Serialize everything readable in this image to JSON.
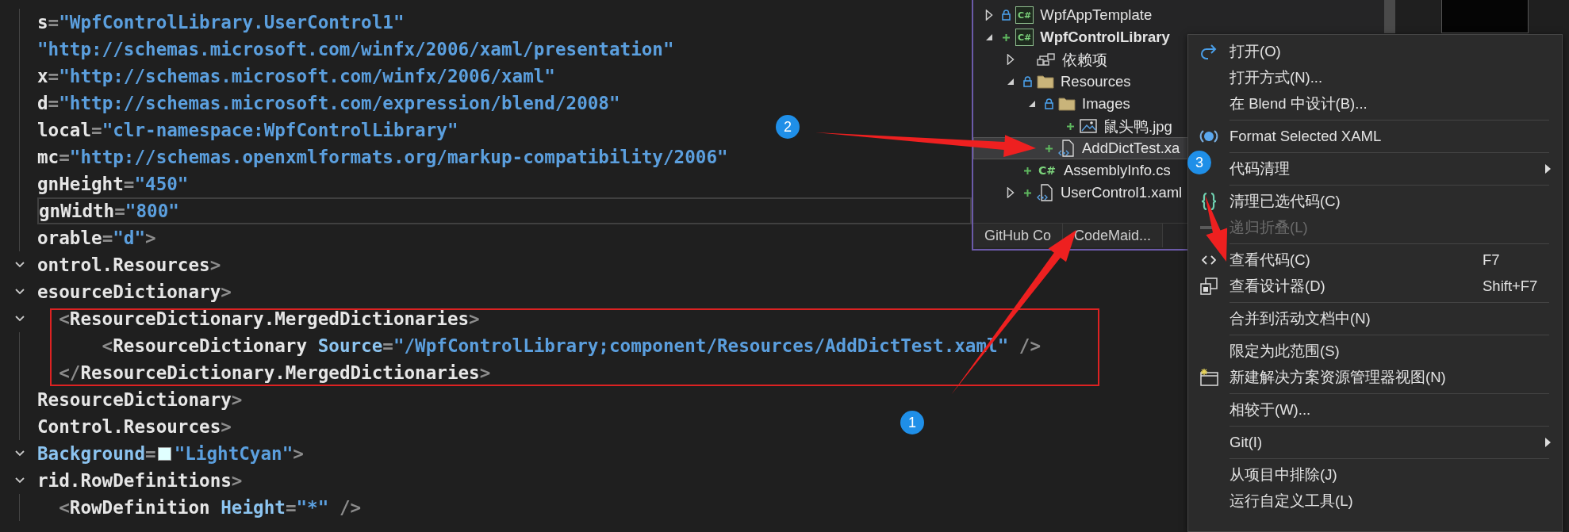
{
  "editor": {
    "lines": [
      {
        "fold": false,
        "current": false,
        "tokens": [
          {
            "t": "s",
            "kind": "name"
          },
          {
            "t": "=",
            "kind": "punct"
          },
          {
            "t": "\"WpfControlLibrary.UserControl1\"",
            "kind": "value"
          }
        ]
      },
      {
        "fold": false,
        "current": false,
        "tokens": [
          {
            "t": "\"http://schemas.microsoft.com/winfx/2006/xaml/presentation\"",
            "kind": "value"
          }
        ]
      },
      {
        "fold": false,
        "current": false,
        "tokens": [
          {
            "t": "x",
            "kind": "name"
          },
          {
            "t": "=",
            "kind": "punct"
          },
          {
            "t": "\"http://schemas.microsoft.com/winfx/2006/xaml\"",
            "kind": "value"
          }
        ]
      },
      {
        "fold": false,
        "current": false,
        "tokens": [
          {
            "t": "d",
            "kind": "name"
          },
          {
            "t": "=",
            "kind": "punct"
          },
          {
            "t": "\"http://schemas.microsoft.com/expression/blend/2008\"",
            "kind": "value"
          }
        ]
      },
      {
        "fold": false,
        "current": false,
        "tokens": [
          {
            "t": "local",
            "kind": "name"
          },
          {
            "t": "=",
            "kind": "punct"
          },
          {
            "t": "\"clr-namespace:WpfControlLibrary\"",
            "kind": "value"
          }
        ]
      },
      {
        "fold": false,
        "current": false,
        "tokens": [
          {
            "t": "mc",
            "kind": "name"
          },
          {
            "t": "=",
            "kind": "punct"
          },
          {
            "t": "\"http://schemas.openxmlformats.org/markup-compatibility/2006\"",
            "kind": "value"
          }
        ]
      },
      {
        "fold": false,
        "current": false,
        "tokens": [
          {
            "t": "gnHeight",
            "kind": "name"
          },
          {
            "t": "=",
            "kind": "punct"
          },
          {
            "t": "\"450\"",
            "kind": "value"
          }
        ]
      },
      {
        "fold": false,
        "current": true,
        "tokens": [
          {
            "t": "gnWidth",
            "kind": "name"
          },
          {
            "t": "=",
            "kind": "punct"
          },
          {
            "t": "\"800\"",
            "kind": "value"
          }
        ]
      },
      {
        "fold": false,
        "current": false,
        "tokens": [
          {
            "t": "orable",
            "kind": "name"
          },
          {
            "t": "=",
            "kind": "punct"
          },
          {
            "t": "\"d\"",
            "kind": "value"
          },
          {
            "t": ">",
            "kind": "punct"
          }
        ]
      },
      {
        "fold": true,
        "current": false,
        "tokens": [
          {
            "t": "ontrol.Resources",
            "kind": "name"
          },
          {
            "t": ">",
            "kind": "punct"
          }
        ]
      },
      {
        "fold": true,
        "current": false,
        "tokens": [
          {
            "t": "esourceDictionary",
            "kind": "name"
          },
          {
            "t": ">",
            "kind": "punct"
          }
        ]
      },
      {
        "fold": true,
        "current": false,
        "tokens": [
          {
            "t": "  <",
            "kind": "punct"
          },
          {
            "t": "ResourceDictionary.MergedDictionaries",
            "kind": "name"
          },
          {
            "t": ">",
            "kind": "punct"
          }
        ]
      },
      {
        "fold": false,
        "current": false,
        "tokens": [
          {
            "t": "      <",
            "kind": "punct"
          },
          {
            "t": "ResourceDictionary ",
            "kind": "name"
          },
          {
            "t": "Source",
            "kind": "attr"
          },
          {
            "t": "=",
            "kind": "punct"
          },
          {
            "t": "\"/WpfControlLibrary;component/Resources/AddDictTest.xaml\"",
            "kind": "value"
          },
          {
            "t": " />",
            "kind": "punct"
          }
        ]
      },
      {
        "fold": false,
        "current": false,
        "tokens": [
          {
            "t": "  </",
            "kind": "punct"
          },
          {
            "t": "ResourceDictionary.MergedDictionaries",
            "kind": "name"
          },
          {
            "t": ">",
            "kind": "punct"
          }
        ]
      },
      {
        "fold": false,
        "current": false,
        "tokens": [
          {
            "t": "ResourceDictionary",
            "kind": "name"
          },
          {
            "t": ">",
            "kind": "punct"
          }
        ]
      },
      {
        "fold": false,
        "current": false,
        "tokens": [
          {
            "t": "Control.Resources",
            "kind": "name"
          },
          {
            "t": ">",
            "kind": "punct"
          }
        ]
      },
      {
        "fold": true,
        "current": false,
        "tokens": [
          {
            "t": "Background",
            "kind": "attr"
          },
          {
            "t": "=",
            "kind": "punct"
          },
          {
            "kind": "swatch"
          },
          {
            "t": "\"LightCyan\"",
            "kind": "value"
          },
          {
            "t": ">",
            "kind": "punct"
          }
        ]
      },
      {
        "fold": true,
        "current": false,
        "tokens": [
          {
            "t": "rid.RowDefinitions",
            "kind": "name"
          },
          {
            "t": ">",
            "kind": "punct"
          }
        ]
      },
      {
        "fold": false,
        "current": false,
        "tokens": [
          {
            "t": "  <",
            "kind": "punct"
          },
          {
            "t": "RowDefinition ",
            "kind": "name"
          },
          {
            "t": "Height",
            "kind": "attr"
          },
          {
            "t": "=",
            "kind": "punct"
          },
          {
            "t": "\"*\"",
            "kind": "value"
          },
          {
            "t": " />",
            "kind": "punct"
          }
        ]
      }
    ]
  },
  "solution_explorer": {
    "tree": [
      {
        "label": "WpfAppTemplate",
        "expanded": false,
        "locked": true,
        "added": false,
        "kind": "project",
        "glyph": "C#",
        "bold": false,
        "selected": false
      },
      {
        "label": "WpfControlLibrary",
        "expanded": true,
        "locked": false,
        "added": true,
        "kind": "project",
        "glyph": "C#",
        "bold": true,
        "selected": false,
        "children": [
          {
            "label": "依赖项",
            "expanded": false,
            "locked": false,
            "added": false,
            "kind": "dependencies",
            "bold": false,
            "selected": false
          },
          {
            "label": "Resources",
            "expanded": true,
            "locked": true,
            "added": false,
            "kind": "folder",
            "bold": false,
            "selected": false,
            "children": [
              {
                "label": "Images",
                "expanded": true,
                "locked": true,
                "added": false,
                "kind": "folder",
                "bold": false,
                "selected": false,
                "children": [
                  {
                    "label": "鼠头鸭.jpg",
                    "locked": false,
                    "added": true,
                    "kind": "image",
                    "bold": false,
                    "selected": false
                  }
                ]
              },
              {
                "label": "AddDictTest.xa",
                "locked": false,
                "added": true,
                "kind": "xaml",
                "bold": false,
                "selected": true
              }
            ]
          },
          {
            "label": "AssemblyInfo.cs",
            "locked": false,
            "added": true,
            "kind": "code",
            "glyph": "C#",
            "bold": false,
            "selected": false
          },
          {
            "label": "UserControl1.xaml",
            "expanded": false,
            "locked": false,
            "added": true,
            "kind": "xaml",
            "bold": false,
            "selected": false
          }
        ]
      }
    ],
    "tabs": [
      {
        "label": "GitHub Co",
        "selected": false
      },
      {
        "label": "CodeMaid...",
        "selected": false
      }
    ]
  },
  "context_menu": {
    "items": [
      {
        "kind": "open",
        "label": "打开(O)",
        "submenu": false,
        "disabled": false
      },
      {
        "kind": "plain",
        "label": "打开方式(N)...",
        "submenu": false,
        "disabled": false
      },
      {
        "kind": "plain",
        "label": "在 Blend 中设计(B)...",
        "submenu": false,
        "disabled": false
      },
      {
        "kind": "separator"
      },
      {
        "kind": "format",
        "label": "Format Selected XAML",
        "submenu": false,
        "disabled": false
      },
      {
        "kind": "separator"
      },
      {
        "kind": "plain",
        "label": "代码清理",
        "submenu": true,
        "disabled": false
      },
      {
        "kind": "separator"
      },
      {
        "kind": "braces",
        "label": "清理已选代码(C)",
        "submenu": false,
        "disabled": false
      },
      {
        "kind": "dash",
        "label": "递归折叠(L)",
        "submenu": false,
        "disabled": true
      },
      {
        "kind": "separator"
      },
      {
        "kind": "code",
        "label": "查看代码(C)",
        "shortcut": "F7",
        "submenu": false,
        "disabled": false
      },
      {
        "kind": "designer",
        "label": "查看设计器(D)",
        "shortcut": "Shift+F7",
        "submenu": false,
        "disabled": false
      },
      {
        "kind": "separator"
      },
      {
        "kind": "plain",
        "label": "合并到活动文档中(N)",
        "submenu": false,
        "disabled": false
      },
      {
        "kind": "separator"
      },
      {
        "kind": "plain",
        "label": "限定为此范围(S)",
        "submenu": false,
        "disabled": false
      },
      {
        "kind": "new-view",
        "label": "新建解决方案资源管理器视图(N)",
        "submenu": false,
        "disabled": false
      },
      {
        "kind": "separator"
      },
      {
        "kind": "plain",
        "label": "相较于(W)...",
        "submenu": false,
        "disabled": false
      },
      {
        "kind": "separator"
      },
      {
        "kind": "plain",
        "label": "Git(I)",
        "submenu": true,
        "disabled": false
      },
      {
        "kind": "separator"
      },
      {
        "kind": "plain",
        "label": "从项目中排除(J)",
        "submenu": false,
        "disabled": false
      },
      {
        "kind": "plain",
        "label": "运行自定义工具(L)",
        "submenu": false,
        "disabled": false
      }
    ]
  },
  "annotations": [
    {
      "number": "1"
    },
    {
      "number": "2"
    },
    {
      "number": "3"
    }
  ]
}
